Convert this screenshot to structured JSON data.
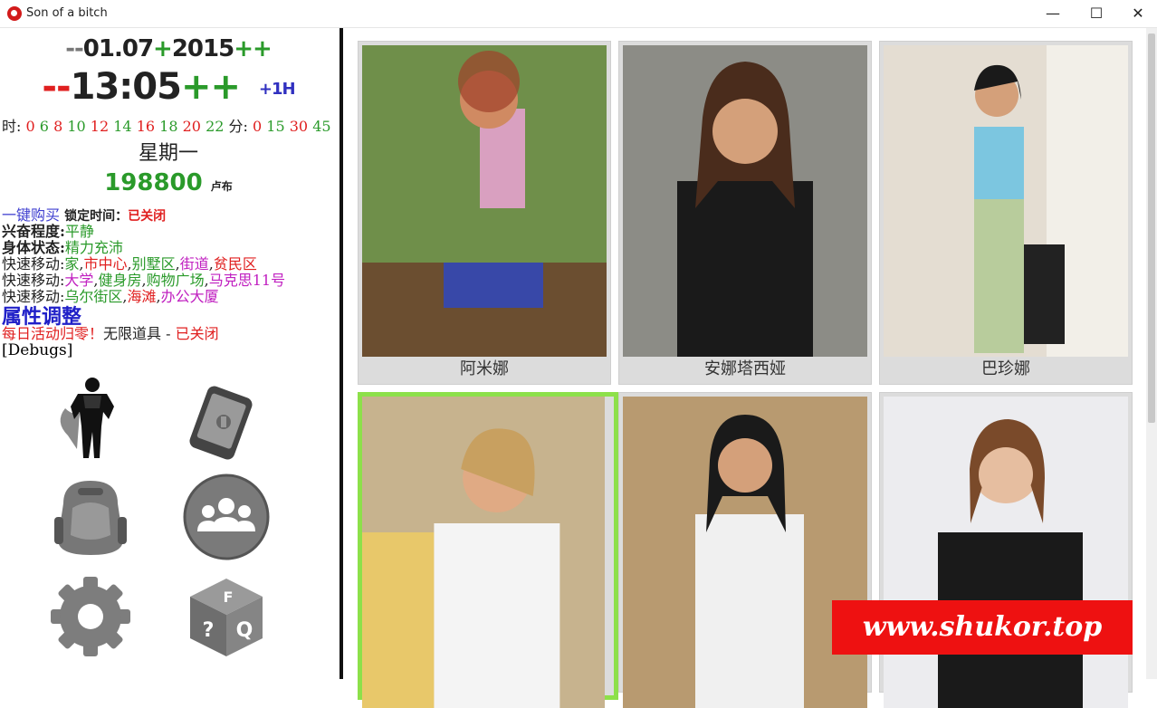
{
  "window": {
    "title": "Son of a bitch",
    "minimize": "—",
    "maximize": "☐",
    "close": "✕"
  },
  "clock": {
    "date_minus": "--",
    "date": "01.07",
    "date_plus": "+",
    "year": "2015",
    "date_plusplus": "++",
    "time_minus": "--",
    "time": "13:05",
    "time_plus": "++",
    "skip": "+1H"
  },
  "hours": {
    "label": "时:",
    "values": [
      "0",
      "6",
      "8",
      "10",
      "12",
      "14",
      "16",
      "18",
      "20",
      "22"
    ],
    "min_label": "分:",
    "minutes": [
      "0",
      "15",
      "30",
      "45"
    ]
  },
  "weekday": "星期一",
  "money": {
    "amount": "198800",
    "unit": "卢布"
  },
  "lines": {
    "buy_all": "一键购买",
    "lock_time": "锁定时间：",
    "lock_state": "已关闭",
    "excite_label": "兴奋程度:",
    "excite_value": "平静",
    "body_label": "身体状态:",
    "body_value": "精力充沛",
    "move_label": "快速移动:",
    "move1": [
      "家",
      "市中心",
      "别墅区",
      "街道",
      "贫民区"
    ],
    "move2": [
      "大学",
      "健身房",
      "购物广场",
      "马克思11号"
    ],
    "move3": [
      "乌尔街区",
      "海滩",
      "办公大厦"
    ],
    "attr": "属性调整",
    "daily": "每日活动归零！",
    "infinite": "无限道具 - ",
    "infinite_state": "已关闭",
    "debugs": "[Debugs]"
  },
  "icons": [
    "hero-icon",
    "phone-icon",
    "backpack-icon",
    "group-icon",
    "gear-icon",
    "faq-cube-icon"
  ],
  "cards": [
    {
      "name": "阿米娜"
    },
    {
      "name": "安娜塔西娅"
    },
    {
      "name": "巴珍娜"
    },
    {
      "name": ""
    },
    {
      "name": ""
    },
    {
      "name": ""
    }
  ],
  "watermark": "www.shukor.top"
}
